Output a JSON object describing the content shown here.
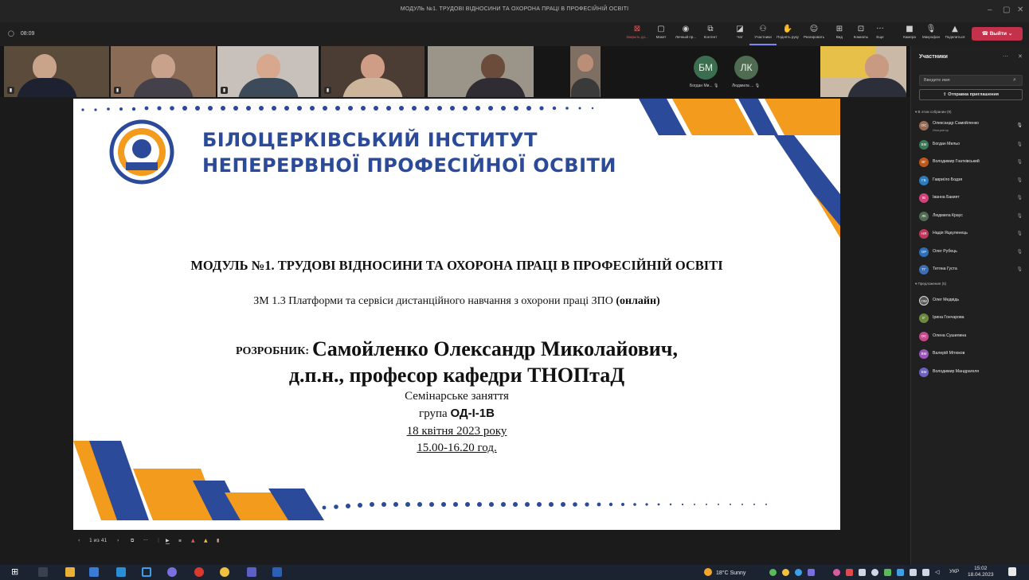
{
  "window": {
    "title": "МОДУЛЬ №1. ТРУДОВІ ВІДНОСИНИ ТА ОХОРОНА ПРАЦІ В ПРОФЕСІЙНІЙ ОСВІТІ"
  },
  "toolbar": {
    "timer": "08:09",
    "buttons": [
      {
        "label": "Закрыть до...",
        "icon": "stop-share-icon"
      },
      {
        "label": "Макет",
        "icon": "layout-icon"
      },
      {
        "label": "Личный пр...",
        "icon": "eye-icon"
      },
      {
        "label": "Контент",
        "icon": "content-icon"
      },
      {
        "label": "Чат",
        "icon": "chat-icon"
      },
      {
        "label": "Участники",
        "icon": "people-icon"
      },
      {
        "label": "Поднять руку",
        "icon": "hand-icon"
      },
      {
        "label": "Реагировать",
        "icon": "smile-icon"
      },
      {
        "label": "Вид",
        "icon": "view-icon"
      },
      {
        "label": "Комнаты",
        "icon": "rooms-icon"
      },
      {
        "label": "Еще",
        "icon": "more-icon"
      },
      {
        "label": "Камера",
        "icon": "camera-icon"
      },
      {
        "label": "Микрофон",
        "icon": "mic-icon"
      },
      {
        "label": "Поделиться",
        "icon": "share-icon"
      }
    ],
    "leave_label": "Выйти"
  },
  "strip": {
    "avatars": [
      {
        "initials": "БМ",
        "name": "Богдан Ми..."
      },
      {
        "initials": "ЛК",
        "name": "Людмила ..."
      }
    ]
  },
  "slide": {
    "institute_line1": "БІЛОЦЕРКІВСЬКИЙ ІНСТИТУТ",
    "institute_line2": "НЕПЕРЕРВНОЇ ПРОФЕСІЙНОЇ ОСВІТИ",
    "title": "МОДУЛЬ №1. ТРУДОВІ ВІДНОСИНИ ТА ОХОРОНА ПРАЦІ В ПРОФЕСІЙНІЙ ОСВІТІ",
    "subtitle": "ЗМ 1.3 Платформи та сервіси дистанційного навчання з охорони праці ЗПО",
    "subtitle_bold": "(онлайн)",
    "developer_label": "РОЗРОБНИК:",
    "developer_name": "Самойленко Олександр Миколайович,",
    "developer_title": "д.п.н., професор кафедри ТНОПтаД",
    "session": "Семінарське заняття",
    "group_prefix": "група",
    "group": "ОД-І-1В",
    "date": "18 квітня 2023  року",
    "time": "15.00-16.20 год."
  },
  "slidenav": {
    "page": "1 из 41"
  },
  "panel": {
    "title": "Участники",
    "search_placeholder": "Введите имя",
    "invite_label": "Отправка приглашения",
    "in_meeting_label": "В этом собрании (9)",
    "participants": [
      {
        "name": "Олександр Самойленко",
        "initials": "ОС",
        "role": "Инициатор",
        "color": "#9a6b55"
      },
      {
        "name": "Богдан Мильо",
        "initials": "БМ",
        "role": "",
        "color": "#3b7a54"
      },
      {
        "name": "Володимир Гнатківський",
        "initials": "ВГ",
        "role": "",
        "color": "#c2571a"
      },
      {
        "name": "Гавриїло Бодзя",
        "initials": "ГБ",
        "role": "",
        "color": "#2e7bbd"
      },
      {
        "name": "Іванна Бакият",
        "initials": "ІБ",
        "role": "",
        "color": "#d1437b"
      },
      {
        "name": "Людмила Краус",
        "initials": "ЛК",
        "role": "",
        "color": "#4f6b52"
      },
      {
        "name": "Надія Яцкуленець",
        "initials": "НЯ",
        "role": "",
        "color": "#c2385c"
      },
      {
        "name": "Олег Рубець",
        "initials": "ОР",
        "role": "",
        "color": "#2e6fb8"
      },
      {
        "name": "Тетяна Густа",
        "initials": "ТГ",
        "role": "",
        "color": "#3f6db3"
      }
    ],
    "suggested_label": "Предложения (5)",
    "suggested": [
      {
        "name": "Олег Медвідь",
        "initials": "ОМ",
        "color": "#555555"
      },
      {
        "name": "Ірина Гончарова",
        "initials": "ІГ",
        "color": "#6c8a3c"
      },
      {
        "name": "Олена Сушилина",
        "initials": "ОС",
        "color": "#c24a8a"
      },
      {
        "name": "Валерій Мітюков",
        "initials": "ВМ",
        "color": "#9b57b8"
      },
      {
        "name": "Володимир Мандрагеля",
        "initials": "ВМ",
        "color": "#6d62c4"
      }
    ]
  },
  "taskbar": {
    "weather": "18°C  Sunny",
    "lang": "УКР",
    "time": "15:02",
    "date": "18.04.2023"
  }
}
